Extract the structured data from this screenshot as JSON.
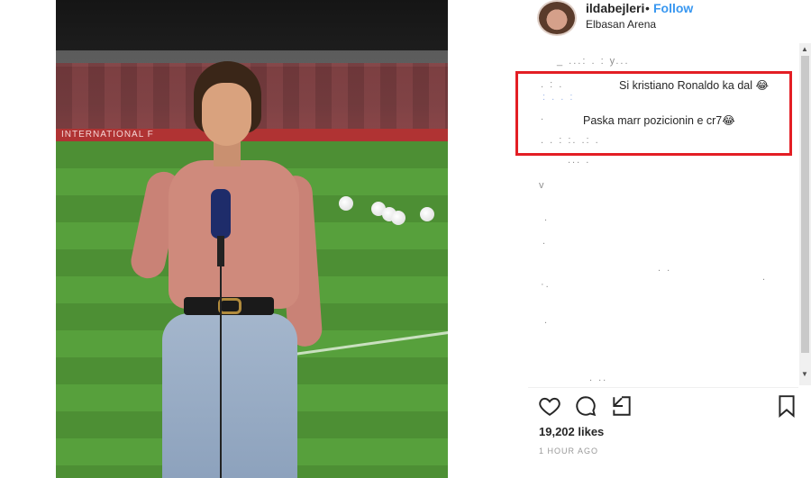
{
  "post": {
    "username": "ildabejleri",
    "separator": "•",
    "follow_label": "Follow",
    "location": "Elbasan Arena",
    "photo_banner_text": "INTERNATIONAL F"
  },
  "comments": {
    "highlighted_1": "Si kristiano Ronaldo ka dal 😂",
    "highlighted_2": "Paska marr pozicionin e cr7😂"
  },
  "actions": {
    "likes": "19,202 likes",
    "timestamp": "1 HOUR AGO"
  },
  "icons": [
    "heart-icon",
    "comment-icon",
    "share-icon",
    "bookmark-icon"
  ],
  "colors": {
    "follow": "#3897f0",
    "highlight_border": "#e31e24",
    "text": "#262626"
  }
}
